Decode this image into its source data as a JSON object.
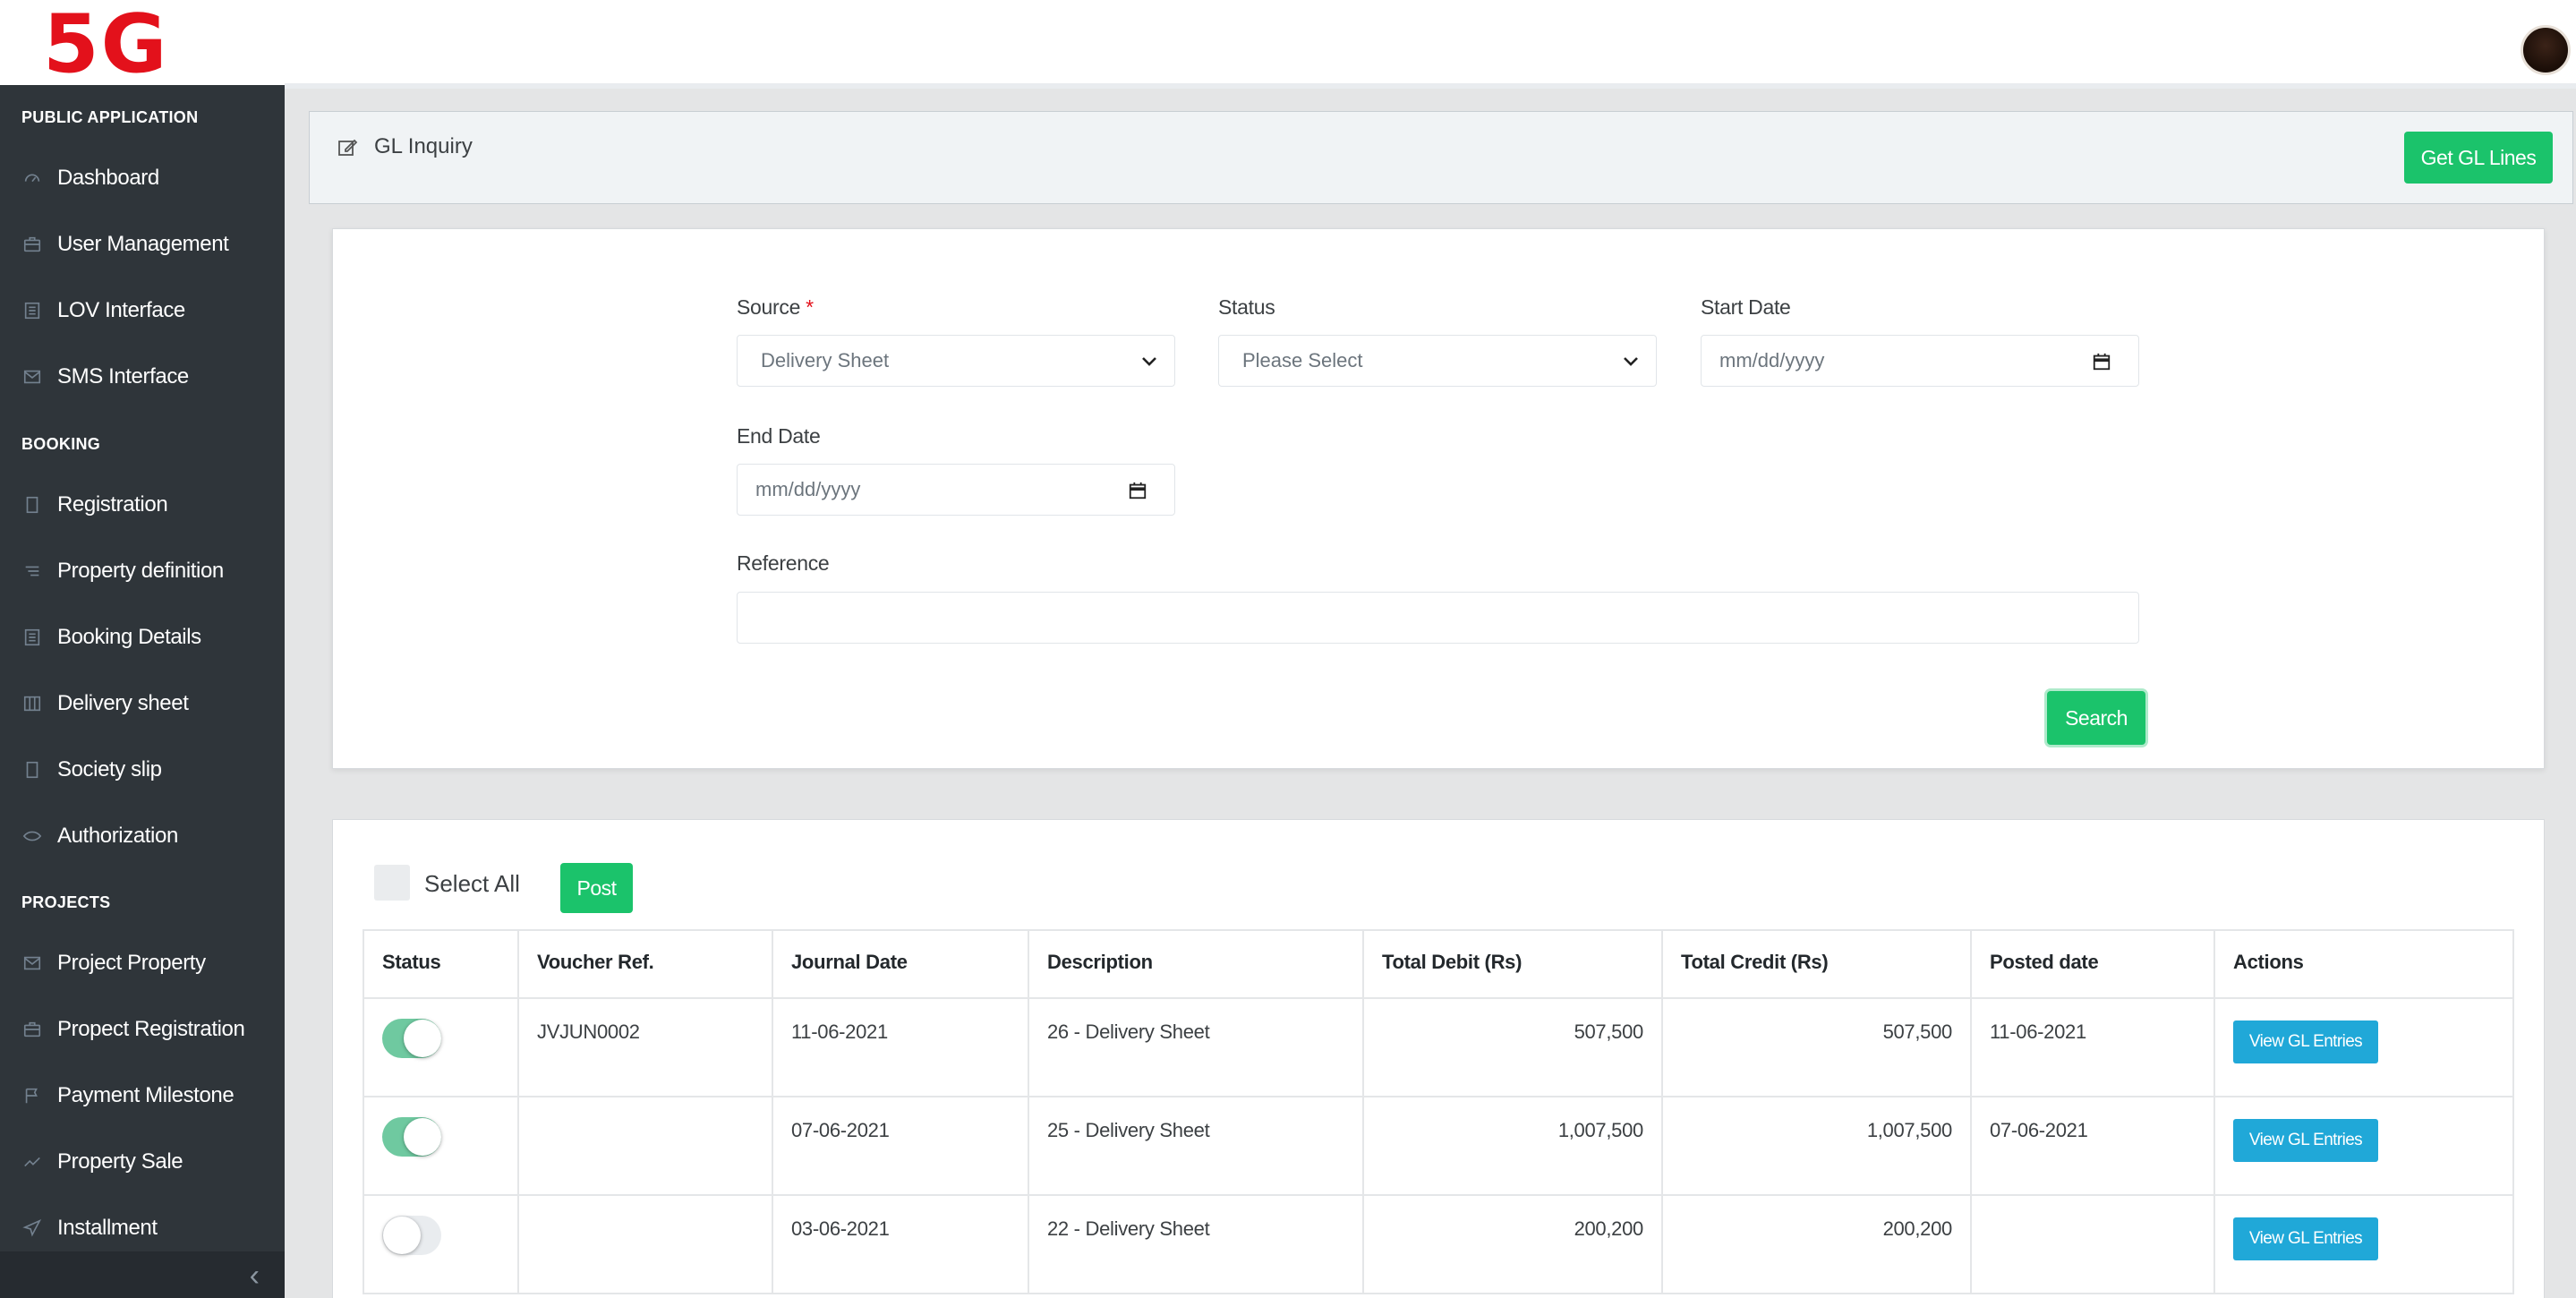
{
  "brand": {
    "logo_text": "5G"
  },
  "sidebar": {
    "sections": [
      {
        "title": "PUBLIC APPLICATION"
      },
      {
        "title": "BOOKING"
      },
      {
        "title": "PROJECTS"
      }
    ],
    "items": [
      {
        "label": "Dashboard",
        "icon": "speedometer-icon"
      },
      {
        "label": "User Management",
        "icon": "briefcase-icon"
      },
      {
        "label": "LOV Interface",
        "icon": "list-icon"
      },
      {
        "label": "SMS Interface",
        "icon": "envelope-icon"
      },
      {
        "label": "Registration",
        "icon": "file-icon"
      },
      {
        "label": "Property definition",
        "icon": "tag-icon"
      },
      {
        "label": "Booking Details",
        "icon": "list-icon"
      },
      {
        "label": "Delivery sheet",
        "icon": "columns-icon"
      },
      {
        "label": "Society slip",
        "icon": "file-icon"
      },
      {
        "label": "Authorization",
        "icon": "eye-icon"
      },
      {
        "label": "Project Property",
        "icon": "envelope-icon"
      },
      {
        "label": "Propect Registration",
        "icon": "briefcase-icon"
      },
      {
        "label": "Payment Milestone",
        "icon": "flag-icon"
      },
      {
        "label": "Property Sale",
        "icon": "chart-line-icon"
      },
      {
        "label": "Installment",
        "icon": "paper-plane-icon"
      }
    ]
  },
  "header": {
    "title": "GL Inquiry",
    "icon": "edit-icon",
    "get_gl_lines_label": "Get GL Lines"
  },
  "filters": {
    "source_label": "Source",
    "source_required_mark": "*",
    "source_value": "Delivery Sheet",
    "status_label": "Status",
    "status_value": "Please Select",
    "start_date_label": "Start Date",
    "start_date_placeholder": "mm/dd/yyyy",
    "end_date_label": "End Date",
    "end_date_placeholder": "mm/dd/yyyy",
    "reference_label": "Reference",
    "reference_value": "",
    "search_label": "Search"
  },
  "table_controls": {
    "select_all_label": "Select All",
    "post_label": "Post"
  },
  "table": {
    "columns": [
      "Status",
      "Voucher Ref.",
      "Journal Date",
      "Description",
      "Total Debit (Rs)",
      "Total Credit (Rs)",
      "Posted date",
      "Actions"
    ],
    "rows": [
      {
        "status_on": true,
        "voucher_ref": "JVJUN0002",
        "journal_date": "11-06-2021",
        "description": "26 - Delivery Sheet",
        "total_debit": "507,500",
        "total_credit": "507,500",
        "posted_date": "11-06-2021",
        "action_label": "View GL Entries"
      },
      {
        "status_on": true,
        "voucher_ref": "",
        "journal_date": "07-06-2021",
        "description": "25 - Delivery Sheet",
        "total_debit": "1,007,500",
        "total_credit": "1,007,500",
        "posted_date": "07-06-2021",
        "action_label": "View GL Entries"
      },
      {
        "status_on": false,
        "voucher_ref": "",
        "journal_date": "03-06-2021",
        "description": "22 - Delivery Sheet",
        "total_debit": "200,200",
        "total_credit": "200,200",
        "posted_date": "",
        "action_label": "View GL Entries"
      }
    ]
  },
  "colors": {
    "sidebar_bg": "#2f353a",
    "primary_green": "#1bc36b",
    "info_blue": "#20a8d8",
    "logo_red": "#e3111b",
    "toggle_on": "#6fc9a0"
  }
}
